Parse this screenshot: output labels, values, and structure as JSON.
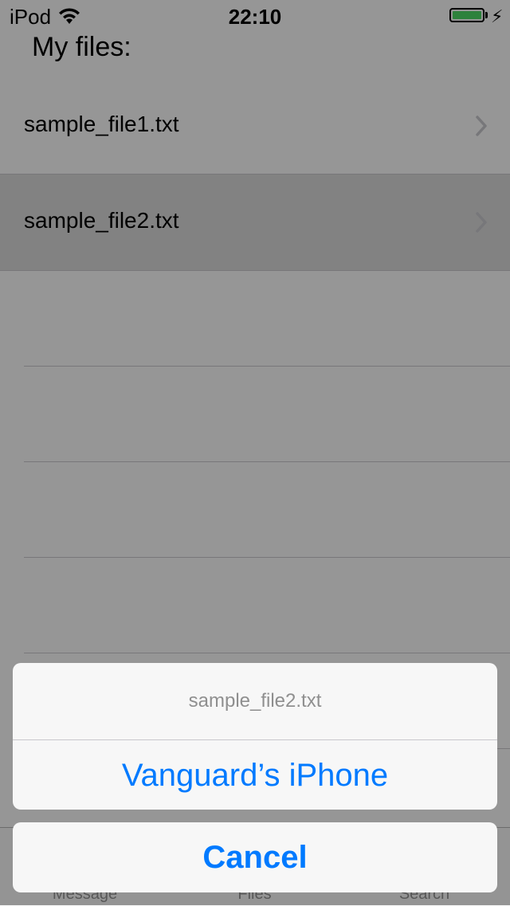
{
  "status_bar": {
    "carrier": "iPod",
    "time": "22:10",
    "icons": [
      "wifi-icon",
      "battery-icon",
      "charging-icon"
    ]
  },
  "page": {
    "title": "My files:"
  },
  "files": [
    {
      "name": "sample_file1.txt",
      "selected": false
    },
    {
      "name": "sample_file2.txt",
      "selected": true
    }
  ],
  "tab_bar": {
    "tabs": [
      {
        "label": "Message"
      },
      {
        "label": "Files"
      },
      {
        "label": "Search"
      }
    ]
  },
  "action_sheet": {
    "title": "sample_file2.txt",
    "action_label": "Vanguard’s iPhone",
    "cancel_label": "Cancel"
  },
  "colors": {
    "accent": "#007aff",
    "battery": "#4cd964"
  }
}
